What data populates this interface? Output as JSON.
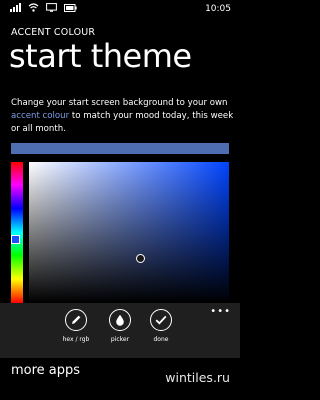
{
  "status_bar": {
    "time": "10:05",
    "icons": [
      "signal-icon",
      "wifi-icon",
      "screen-projection-icon",
      "battery-icon"
    ]
  },
  "header": {
    "section": "ACCENT COLOUR",
    "title": "start theme"
  },
  "description": {
    "before": "Change your start screen background to your own ",
    "link": "accent colour",
    "after": " to match your mood today, this week or all month."
  },
  "colors": {
    "selected": "#4f6eb2",
    "link": "#7c9ee6",
    "hue_selector": "#1e50ff"
  },
  "app_bar": {
    "buttons": [
      {
        "icon": "pencil-icon",
        "label": "hex / rgb"
      },
      {
        "icon": "droplet-icon",
        "label": "picker"
      },
      {
        "icon": "checkmark-icon",
        "label": "done"
      }
    ],
    "more": "•••"
  },
  "footer": {
    "more_apps": "more apps",
    "watermark": "wintiles.ru"
  }
}
